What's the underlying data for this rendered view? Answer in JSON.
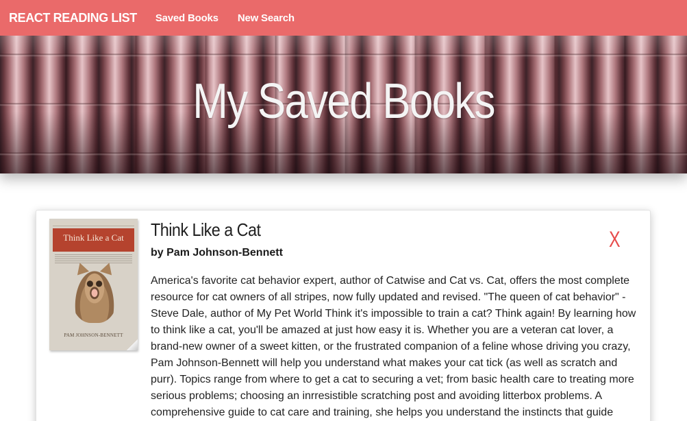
{
  "navbar": {
    "brand": "REACT READING LIST",
    "links": [
      "Saved Books",
      "New Search"
    ],
    "color": "#ea6a6a"
  },
  "hero": {
    "title": "My Saved Books"
  },
  "book": {
    "title": "Think Like a Cat",
    "author": "by Pam Johnson-Bennett",
    "delete_label": "X",
    "delete_color": "#e74c4c",
    "description": "America's favorite cat behavior expert, author of Catwise and Cat vs. Cat, offers the most complete resource for cat owners of all stripes, now fully updated and revised. \"The queen of cat behavior\" - Steve Dale, author of My Pet World Think it's impossible to train a cat? Think again! By learning how to think like a cat, you'll be amazed at just how easy it is. Whether you are a veteran cat lover, a brand-new owner of a sweet kitten, or the frustrated companion of a feline whose driving you crazy, Pam Johnson-Bennett will help you understand what makes your cat tick (as well as scratch and purr). Topics range from where to get a cat to securing a vet; from basic health care to treating more serious problems; choosing an inrresistible scratching post and avoiding litterbox problems. A comprehensive guide to cat care and training, she helps you understand the instincts that guide",
    "cover": {
      "icon": "book-cover-image",
      "title": "Think Like a Cat",
      "author": "PAM JOHNSON-BENNETT"
    }
  }
}
